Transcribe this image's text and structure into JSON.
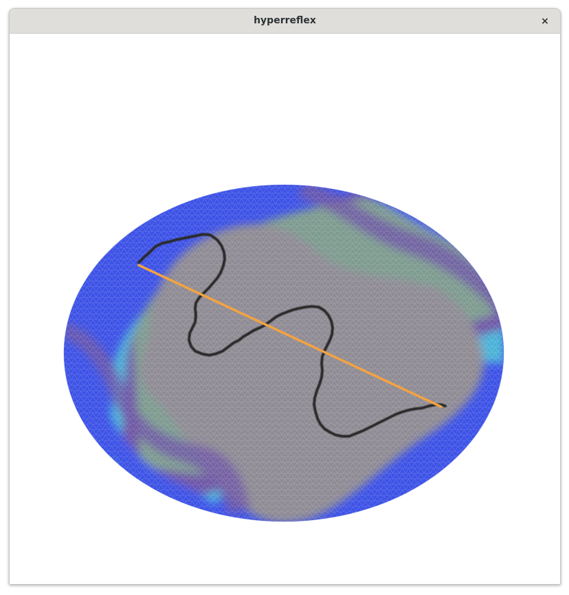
{
  "window": {
    "title": "hyperreflex",
    "close_glyph": "×",
    "close_icon": "close-icon"
  },
  "viewport": {
    "background": "#ffffff",
    "mesh": {
      "shape": "elliptical triangulated mesh (disk viewed in perspective)",
      "band_colors": [
        "#8f8b94",
        "#7e9b90",
        "#6f57a6",
        "#4bb3d8",
        "#3d52e6"
      ],
      "grid_color": "#ffffff"
    },
    "path_color": "#2b2b2b",
    "line_color": "#f4a340"
  }
}
